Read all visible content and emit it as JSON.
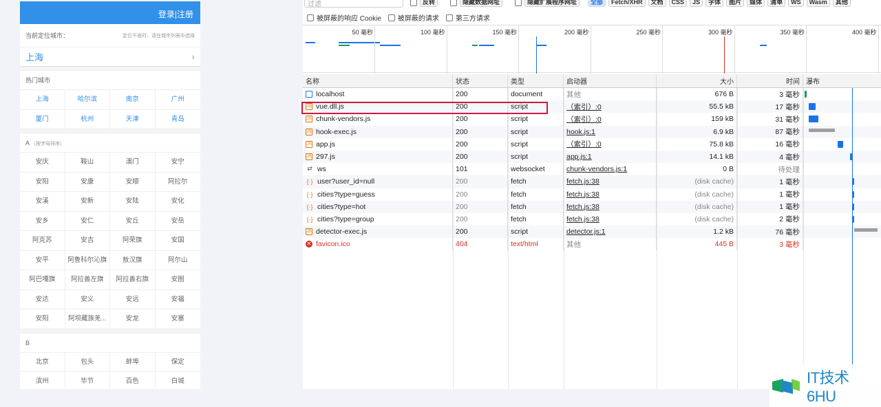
{
  "app": {
    "header_label": "登录|注册",
    "locate_label": "当前定位城市：",
    "locate_hint": "定位不准时，请在城市列表中选择",
    "current_city": "上海",
    "hot_title": "热门城市",
    "hot_cities": [
      "上海",
      "哈尔滨",
      "南京",
      "广州",
      "厦门",
      "杭州",
      "天津",
      "青岛"
    ],
    "group_a_title": "A",
    "group_a_sub": "（按字母排序）",
    "group_a_cities": [
      "安庆",
      "鞍山",
      "澳门",
      "安宁",
      "安阳",
      "安康",
      "安顺",
      "阿拉尔",
      "安溪",
      "安新",
      "安陆",
      "安化",
      "安乡",
      "安仁",
      "安丘",
      "安岳",
      "阿克苏",
      "安吉",
      "阿荣旗",
      "安国",
      "安平",
      "阿鲁科尔沁旗",
      "敖汉旗",
      "阿尔山",
      "阿巴嘎旗",
      "阿拉善左旗",
      "阿拉善右旗",
      "安图",
      "安达",
      "安义",
      "安远",
      "安福",
      "安阳",
      "阿坝藏族羌...",
      "安龙",
      "安塞"
    ],
    "group_b_title": "B",
    "group_b_cities": [
      "北京",
      "包头",
      "蚌埠",
      "保定",
      "滨州",
      "毕节",
      "百色",
      "白城"
    ]
  },
  "devtools": {
    "filter_placeholder": "过滤",
    "invert_label": "反转",
    "hide_data_urls": "隐藏数据网址",
    "hide_ext_urls": "隐藏扩展程序网址",
    "type_filters": [
      "全部",
      "Fetch/XHR",
      "文档",
      "CSS",
      "JS",
      "字体",
      "图片",
      "媒体",
      "清单",
      "WS",
      "Wasm",
      "其他"
    ],
    "blocked_cookies": "被屏蔽的响应 Cookie",
    "blocked_requests": "被屏蔽的请求",
    "third_party": "第三方请求",
    "ticks": [
      "50 毫秒",
      "100 毫秒",
      "150 毫秒",
      "200 毫秒",
      "250 毫秒",
      "300 毫秒",
      "350 毫秒",
      "400 毫秒"
    ],
    "columns": [
      "名称",
      "状态",
      "类型",
      "启动器",
      "大小",
      "时间",
      "瀑布"
    ],
    "rows": [
      {
        "name": "localhost",
        "status": "200",
        "type": "document",
        "initiator": "其他",
        "size": "676 B",
        "time": "3 毫秒",
        "icon": "document-icon"
      },
      {
        "name": "vue.dll.js",
        "status": "200",
        "type": "script",
        "initiator": "（索引）:0",
        "size": "55.5 kB",
        "time": "17 毫秒",
        "icon": "script-icon"
      },
      {
        "name": "chunk-vendors.js",
        "status": "200",
        "type": "script",
        "initiator": "（索引）:0",
        "size": "159 kB",
        "time": "31 毫秒",
        "icon": "script-icon"
      },
      {
        "name": "hook-exec.js",
        "status": "200",
        "type": "script",
        "initiator": "hook.js:1",
        "size": "6.9 kB",
        "time": "87 毫秒",
        "icon": "script-icon"
      },
      {
        "name": "app.js",
        "status": "200",
        "type": "script",
        "initiator": "（索引）:0",
        "size": "75.8 kB",
        "time": "16 毫秒",
        "icon": "script-icon"
      },
      {
        "name": "297.js",
        "status": "200",
        "type": "script",
        "initiator": "app.js:1",
        "size": "14.1 kB",
        "time": "4 毫秒",
        "icon": "script-icon"
      },
      {
        "name": "ws",
        "status": "101",
        "type": "websocket",
        "initiator": "chunk-vendors.js:1",
        "size": "0 B",
        "time": "待处理",
        "icon": "websocket-icon"
      },
      {
        "name": "user?user_id=null",
        "status": "200",
        "type": "fetch",
        "initiator": "fetch.js:38",
        "size": "(disk cache)",
        "time": "1 毫秒",
        "icon": "fetch-icon"
      },
      {
        "name": "cities?type=guess",
        "status": "200",
        "type": "fetch",
        "initiator": "fetch.js:38",
        "size": "(disk cache)",
        "time": "1 毫秒",
        "icon": "fetch-icon"
      },
      {
        "name": "cities?type=hot",
        "status": "200",
        "type": "fetch",
        "initiator": "fetch.js:38",
        "size": "(disk cache)",
        "time": "1 毫秒",
        "icon": "fetch-icon"
      },
      {
        "name": "cities?type=group",
        "status": "200",
        "type": "fetch",
        "initiator": "fetch.js:38",
        "size": "(disk cache)",
        "time": "2 毫秒",
        "icon": "fetch-icon"
      },
      {
        "name": "detector-exec.js",
        "status": "200",
        "type": "script",
        "initiator": "detector.js:1",
        "size": "1.2 kB",
        "time": "76 毫秒",
        "icon": "script-icon"
      },
      {
        "name": "favicon.ico",
        "status": "404",
        "type": "text/html",
        "initiator": "其他",
        "size": "445 B",
        "time": "3 毫秒",
        "icon": "error-icon"
      }
    ]
  },
  "watermark": {
    "text": "IT技术6HU"
  },
  "colors": {
    "accent": "#3190e8",
    "error": "#d93025",
    "highlight": "#d0183c",
    "devtools_blue": "#1a73e8"
  }
}
